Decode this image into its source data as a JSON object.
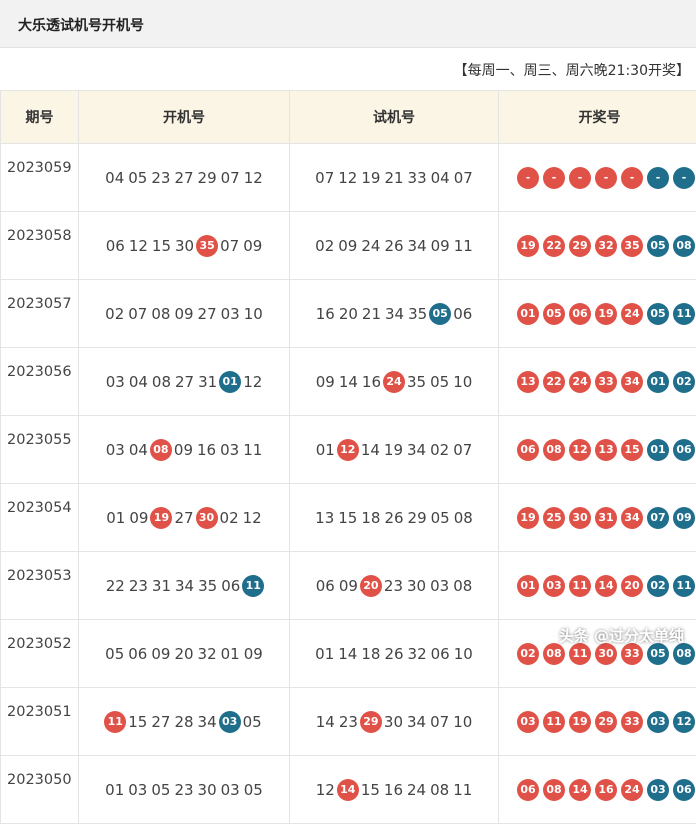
{
  "header": {
    "title": "大乐透试机号开机号"
  },
  "schedule": "【每周一、周三、周六晚21:30开奖】",
  "table": {
    "columns": [
      "期号",
      "开机号",
      "试机号",
      "开奖号"
    ],
    "rows": [
      {
        "issue": "2023059",
        "kj": [
          [
            "04",
            "n"
          ],
          [
            "05",
            "n"
          ],
          [
            "23",
            "n"
          ],
          [
            "27",
            "n"
          ],
          [
            "29",
            "n"
          ],
          [
            "07",
            "n"
          ],
          [
            "12",
            "n"
          ]
        ],
        "sj": [
          [
            "07",
            "n"
          ],
          [
            "12",
            "n"
          ],
          [
            "19",
            "n"
          ],
          [
            "21",
            "n"
          ],
          [
            "33",
            "n"
          ],
          [
            "04",
            "n"
          ],
          [
            "07",
            "n"
          ]
        ],
        "prize": [
          [
            "-",
            "r"
          ],
          [
            "-",
            "r"
          ],
          [
            "-",
            "r"
          ],
          [
            "-",
            "r"
          ],
          [
            "-",
            "r"
          ],
          [
            "-",
            "b"
          ],
          [
            "-",
            "b"
          ]
        ]
      },
      {
        "issue": "2023058",
        "kj": [
          [
            "06",
            "n"
          ],
          [
            "12",
            "n"
          ],
          [
            "15",
            "n"
          ],
          [
            "30",
            "n"
          ],
          [
            "35",
            "r"
          ],
          [
            "07",
            "n"
          ],
          [
            "09",
            "n"
          ]
        ],
        "sj": [
          [
            "02",
            "n"
          ],
          [
            "09",
            "n"
          ],
          [
            "24",
            "n"
          ],
          [
            "26",
            "n"
          ],
          [
            "34",
            "n"
          ],
          [
            "09",
            "n"
          ],
          [
            "11",
            "n"
          ]
        ],
        "prize": [
          [
            "19",
            "r"
          ],
          [
            "22",
            "r"
          ],
          [
            "29",
            "r"
          ],
          [
            "32",
            "r"
          ],
          [
            "35",
            "r"
          ],
          [
            "05",
            "b"
          ],
          [
            "08",
            "b"
          ]
        ]
      },
      {
        "issue": "2023057",
        "kj": [
          [
            "02",
            "n"
          ],
          [
            "07",
            "n"
          ],
          [
            "08",
            "n"
          ],
          [
            "09",
            "n"
          ],
          [
            "27",
            "n"
          ],
          [
            "03",
            "n"
          ],
          [
            "10",
            "n"
          ]
        ],
        "sj": [
          [
            "16",
            "n"
          ],
          [
            "20",
            "n"
          ],
          [
            "21",
            "n"
          ],
          [
            "34",
            "n"
          ],
          [
            "35",
            "n"
          ],
          [
            "05",
            "b"
          ],
          [
            "06",
            "n"
          ]
        ],
        "prize": [
          [
            "01",
            "r"
          ],
          [
            "05",
            "r"
          ],
          [
            "06",
            "r"
          ],
          [
            "19",
            "r"
          ],
          [
            "24",
            "r"
          ],
          [
            "05",
            "b"
          ],
          [
            "11",
            "b"
          ]
        ]
      },
      {
        "issue": "2023056",
        "kj": [
          [
            "03",
            "n"
          ],
          [
            "04",
            "n"
          ],
          [
            "08",
            "n"
          ],
          [
            "27",
            "n"
          ],
          [
            "31",
            "n"
          ],
          [
            "01",
            "b"
          ],
          [
            "12",
            "n"
          ]
        ],
        "sj": [
          [
            "09",
            "n"
          ],
          [
            "14",
            "n"
          ],
          [
            "16",
            "n"
          ],
          [
            "24",
            "r"
          ],
          [
            "35",
            "n"
          ],
          [
            "05",
            "n"
          ],
          [
            "10",
            "n"
          ]
        ],
        "prize": [
          [
            "13",
            "r"
          ],
          [
            "22",
            "r"
          ],
          [
            "24",
            "r"
          ],
          [
            "33",
            "r"
          ],
          [
            "34",
            "r"
          ],
          [
            "01",
            "b"
          ],
          [
            "02",
            "b"
          ]
        ]
      },
      {
        "issue": "2023055",
        "kj": [
          [
            "03",
            "n"
          ],
          [
            "04",
            "n"
          ],
          [
            "08",
            "r"
          ],
          [
            "09",
            "n"
          ],
          [
            "16",
            "n"
          ],
          [
            "03",
            "n"
          ],
          [
            "11",
            "n"
          ]
        ],
        "sj": [
          [
            "01",
            "n"
          ],
          [
            "12",
            "r"
          ],
          [
            "14",
            "n"
          ],
          [
            "19",
            "n"
          ],
          [
            "34",
            "n"
          ],
          [
            "02",
            "n"
          ],
          [
            "07",
            "n"
          ]
        ],
        "prize": [
          [
            "06",
            "r"
          ],
          [
            "08",
            "r"
          ],
          [
            "12",
            "r"
          ],
          [
            "13",
            "r"
          ],
          [
            "15",
            "r"
          ],
          [
            "01",
            "b"
          ],
          [
            "06",
            "b"
          ]
        ]
      },
      {
        "issue": "2023054",
        "kj": [
          [
            "01",
            "n"
          ],
          [
            "09",
            "n"
          ],
          [
            "19",
            "r"
          ],
          [
            "27",
            "n"
          ],
          [
            "30",
            "r"
          ],
          [
            "02",
            "n"
          ],
          [
            "12",
            "n"
          ]
        ],
        "sj": [
          [
            "13",
            "n"
          ],
          [
            "15",
            "n"
          ],
          [
            "18",
            "n"
          ],
          [
            "26",
            "n"
          ],
          [
            "29",
            "n"
          ],
          [
            "05",
            "n"
          ],
          [
            "08",
            "n"
          ]
        ],
        "prize": [
          [
            "19",
            "r"
          ],
          [
            "25",
            "r"
          ],
          [
            "30",
            "r"
          ],
          [
            "31",
            "r"
          ],
          [
            "34",
            "r"
          ],
          [
            "07",
            "b"
          ],
          [
            "09",
            "b"
          ]
        ]
      },
      {
        "issue": "2023053",
        "kj": [
          [
            "22",
            "n"
          ],
          [
            "23",
            "n"
          ],
          [
            "31",
            "n"
          ],
          [
            "34",
            "n"
          ],
          [
            "35",
            "n"
          ],
          [
            "06",
            "n"
          ],
          [
            "11",
            "b"
          ]
        ],
        "sj": [
          [
            "06",
            "n"
          ],
          [
            "09",
            "n"
          ],
          [
            "20",
            "r"
          ],
          [
            "23",
            "n"
          ],
          [
            "30",
            "n"
          ],
          [
            "03",
            "n"
          ],
          [
            "08",
            "n"
          ]
        ],
        "prize": [
          [
            "01",
            "r"
          ],
          [
            "03",
            "r"
          ],
          [
            "11",
            "r"
          ],
          [
            "14",
            "r"
          ],
          [
            "20",
            "r"
          ],
          [
            "02",
            "b"
          ],
          [
            "11",
            "b"
          ]
        ]
      },
      {
        "issue": "2023052",
        "kj": [
          [
            "05",
            "n"
          ],
          [
            "06",
            "n"
          ],
          [
            "09",
            "n"
          ],
          [
            "20",
            "n"
          ],
          [
            "32",
            "n"
          ],
          [
            "01",
            "n"
          ],
          [
            "09",
            "n"
          ]
        ],
        "sj": [
          [
            "01",
            "n"
          ],
          [
            "14",
            "n"
          ],
          [
            "18",
            "n"
          ],
          [
            "26",
            "n"
          ],
          [
            "32",
            "n"
          ],
          [
            "06",
            "n"
          ],
          [
            "10",
            "n"
          ]
        ],
        "prize": [
          [
            "02",
            "r"
          ],
          [
            "08",
            "r"
          ],
          [
            "11",
            "r"
          ],
          [
            "30",
            "r"
          ],
          [
            "33",
            "r"
          ],
          [
            "05",
            "b"
          ],
          [
            "08",
            "b"
          ]
        ]
      },
      {
        "issue": "2023051",
        "kj": [
          [
            "11",
            "r"
          ],
          [
            "15",
            "n"
          ],
          [
            "27",
            "n"
          ],
          [
            "28",
            "n"
          ],
          [
            "34",
            "n"
          ],
          [
            "03",
            "b"
          ],
          [
            "05",
            "n"
          ]
        ],
        "sj": [
          [
            "14",
            "n"
          ],
          [
            "23",
            "n"
          ],
          [
            "29",
            "r"
          ],
          [
            "30",
            "n"
          ],
          [
            "34",
            "n"
          ],
          [
            "07",
            "n"
          ],
          [
            "10",
            "n"
          ]
        ],
        "prize": [
          [
            "03",
            "r"
          ],
          [
            "11",
            "r"
          ],
          [
            "19",
            "r"
          ],
          [
            "29",
            "r"
          ],
          [
            "33",
            "r"
          ],
          [
            "03",
            "b"
          ],
          [
            "12",
            "b"
          ]
        ]
      },
      {
        "issue": "2023050",
        "kj": [
          [
            "01",
            "n"
          ],
          [
            "03",
            "n"
          ],
          [
            "05",
            "n"
          ],
          [
            "23",
            "n"
          ],
          [
            "30",
            "n"
          ],
          [
            "03",
            "n"
          ],
          [
            "05",
            "n"
          ]
        ],
        "sj": [
          [
            "12",
            "n"
          ],
          [
            "14",
            "r"
          ],
          [
            "15",
            "n"
          ],
          [
            "16",
            "n"
          ],
          [
            "24",
            "n"
          ],
          [
            "08",
            "n"
          ],
          [
            "11",
            "n"
          ]
        ],
        "prize": [
          [
            "06",
            "r"
          ],
          [
            "08",
            "r"
          ],
          [
            "14",
            "r"
          ],
          [
            "16",
            "r"
          ],
          [
            "24",
            "r"
          ],
          [
            "03",
            "b"
          ],
          [
            "06",
            "b"
          ]
        ]
      }
    ]
  },
  "watermark": "头条 @过分太单纯"
}
